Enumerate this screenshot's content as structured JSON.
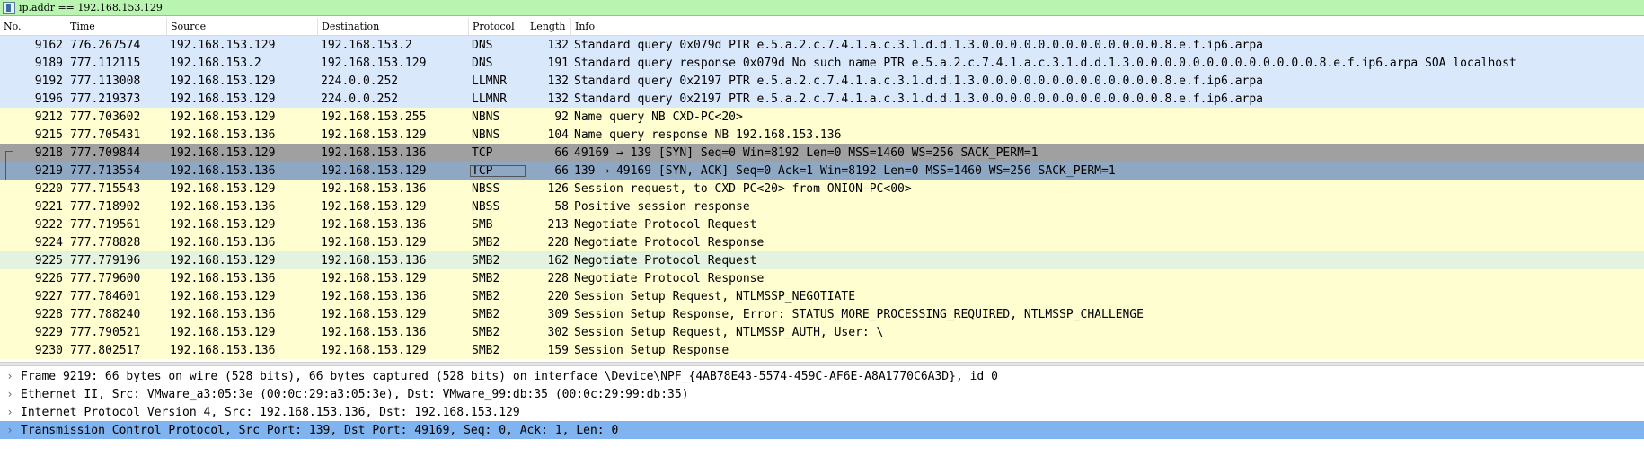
{
  "filter": {
    "value": "ip.addr == 192.168.153.129"
  },
  "columns": [
    "No.",
    "Time",
    "Source",
    "Destination",
    "Protocol",
    "Length",
    "Info"
  ],
  "colors": {
    "filter_bg": "#b9f4b1",
    "dns_bg": "#dae8fc",
    "nb_bg": "#fefed0",
    "tcp_syn_bg": "#a0a0a0",
    "selected_bg": "#8ea8c3",
    "smb2_green_bg": "#e4f2e0",
    "detail_selected_bg": "#7fb4f0"
  },
  "packets": [
    {
      "no": "9162",
      "time": "776.267574",
      "src": "192.168.153.129",
      "dst": "192.168.153.2",
      "proto": "DNS",
      "len": "132",
      "info": "Standard query 0x079d PTR e.5.a.2.c.7.4.1.a.c.3.1.d.d.1.3.0.0.0.0.0.0.0.0.0.0.0.0.0.8.e.f.ip6.arpa",
      "bg": "blue"
    },
    {
      "no": "9189",
      "time": "777.112115",
      "src": "192.168.153.2",
      "dst": "192.168.153.129",
      "proto": "DNS",
      "len": "191",
      "info": "Standard query response 0x079d No such name PTR e.5.a.2.c.7.4.1.a.c.3.1.d.d.1.3.0.0.0.0.0.0.0.0.0.0.0.0.0.8.e.f.ip6.arpa SOA localhost",
      "bg": "blue"
    },
    {
      "no": "9192",
      "time": "777.113008",
      "src": "192.168.153.129",
      "dst": "224.0.0.252",
      "proto": "LLMNR",
      "len": "132",
      "info": "Standard query 0x2197 PTR e.5.a.2.c.7.4.1.a.c.3.1.d.d.1.3.0.0.0.0.0.0.0.0.0.0.0.0.0.8.e.f.ip6.arpa",
      "bg": "blue"
    },
    {
      "no": "9196",
      "time": "777.219373",
      "src": "192.168.153.129",
      "dst": "224.0.0.252",
      "proto": "LLMNR",
      "len": "132",
      "info": "Standard query 0x2197 PTR e.5.a.2.c.7.4.1.a.c.3.1.d.d.1.3.0.0.0.0.0.0.0.0.0.0.0.0.0.8.e.f.ip6.arpa",
      "bg": "blue"
    },
    {
      "no": "9212",
      "time": "777.703602",
      "src": "192.168.153.129",
      "dst": "192.168.153.255",
      "proto": "NBNS",
      "len": "92",
      "info": "Name query NB CXD-PC<20>",
      "bg": "yellow"
    },
    {
      "no": "9215",
      "time": "777.705431",
      "src": "192.168.153.136",
      "dst": "192.168.153.129",
      "proto": "NBNS",
      "len": "104",
      "info": "Name query response NB 192.168.153.136",
      "bg": "yellow"
    },
    {
      "no": "9218",
      "time": "777.709844",
      "src": "192.168.153.129",
      "dst": "192.168.153.136",
      "proto": "TCP",
      "len": "66",
      "info": "49169 → 139 [SYN] Seq=0 Win=8192 Len=0 MSS=1460 WS=256 SACK_PERM=1",
      "bg": "gray"
    },
    {
      "no": "9219",
      "time": "777.713554",
      "src": "192.168.153.136",
      "dst": "192.168.153.129",
      "proto": "TCP",
      "len": "66",
      "info": "139 → 49169 [SYN, ACK] Seq=0 Ack=1 Win=8192 Len=0 MSS=1460 WS=256 SACK_PERM=1",
      "bg": "sel"
    },
    {
      "no": "9220",
      "time": "777.715543",
      "src": "192.168.153.129",
      "dst": "192.168.153.136",
      "proto": "NBSS",
      "len": "126",
      "info": "Session request, to CXD-PC<20> from ONION-PC<00>",
      "bg": "yellow"
    },
    {
      "no": "9221",
      "time": "777.718902",
      "src": "192.168.153.136",
      "dst": "192.168.153.129",
      "proto": "NBSS",
      "len": "58",
      "info": "Positive session response",
      "bg": "yellow"
    },
    {
      "no": "9222",
      "time": "777.719561",
      "src": "192.168.153.129",
      "dst": "192.168.153.136",
      "proto": "SMB",
      "len": "213",
      "info": "Negotiate Protocol Request",
      "bg": "yellow"
    },
    {
      "no": "9224",
      "time": "777.778828",
      "src": "192.168.153.136",
      "dst": "192.168.153.129",
      "proto": "SMB2",
      "len": "228",
      "info": "Negotiate Protocol Response",
      "bg": "yellow"
    },
    {
      "no": "9225",
      "time": "777.779196",
      "src": "192.168.153.129",
      "dst": "192.168.153.136",
      "proto": "SMB2",
      "len": "162",
      "info": "Negotiate Protocol Request",
      "bg": "green"
    },
    {
      "no": "9226",
      "time": "777.779600",
      "src": "192.168.153.136",
      "dst": "192.168.153.129",
      "proto": "SMB2",
      "len": "228",
      "info": "Negotiate Protocol Response",
      "bg": "yellow"
    },
    {
      "no": "9227",
      "time": "777.784601",
      "src": "192.168.153.129",
      "dst": "192.168.153.136",
      "proto": "SMB2",
      "len": "220",
      "info": "Session Setup Request, NTLMSSP_NEGOTIATE",
      "bg": "yellow"
    },
    {
      "no": "9228",
      "time": "777.788240",
      "src": "192.168.153.136",
      "dst": "192.168.153.129",
      "proto": "SMB2",
      "len": "309",
      "info": "Session Setup Response, Error: STATUS_MORE_PROCESSING_REQUIRED, NTLMSSP_CHALLENGE",
      "bg": "yellow"
    },
    {
      "no": "9229",
      "time": "777.790521",
      "src": "192.168.153.129",
      "dst": "192.168.153.136",
      "proto": "SMB2",
      "len": "302",
      "info": "Session Setup Request, NTLMSSP_AUTH, User: \\",
      "bg": "yellow"
    },
    {
      "no": "9230",
      "time": "777.802517",
      "src": "192.168.153.136",
      "dst": "192.168.153.129",
      "proto": "SMB2",
      "len": "159",
      "info": "Session Setup Response",
      "bg": "yellow"
    }
  ],
  "details": [
    {
      "text": "Frame 9219: 66 bytes on wire (528 bits), 66 bytes captured (528 bits) on interface \\Device\\NPF_{4AB78E43-5574-459C-AF6E-A8A1770C6A3D}, id 0",
      "selected": false
    },
    {
      "text": "Ethernet II, Src: VMware_a3:05:3e (00:0c:29:a3:05:3e), Dst: VMware_99:db:35 (00:0c:29:99:db:35)",
      "selected": false
    },
    {
      "text": "Internet Protocol Version 4, Src: 192.168.153.136, Dst: 192.168.153.129",
      "selected": false
    },
    {
      "text": "Transmission Control Protocol, Src Port: 139, Dst Port: 49169, Seq: 0, Ack: 1, Len: 0",
      "selected": true
    }
  ],
  "icons": {
    "filter_bookmark": "bookmark-icon",
    "expand": "chevron-right-icon"
  }
}
